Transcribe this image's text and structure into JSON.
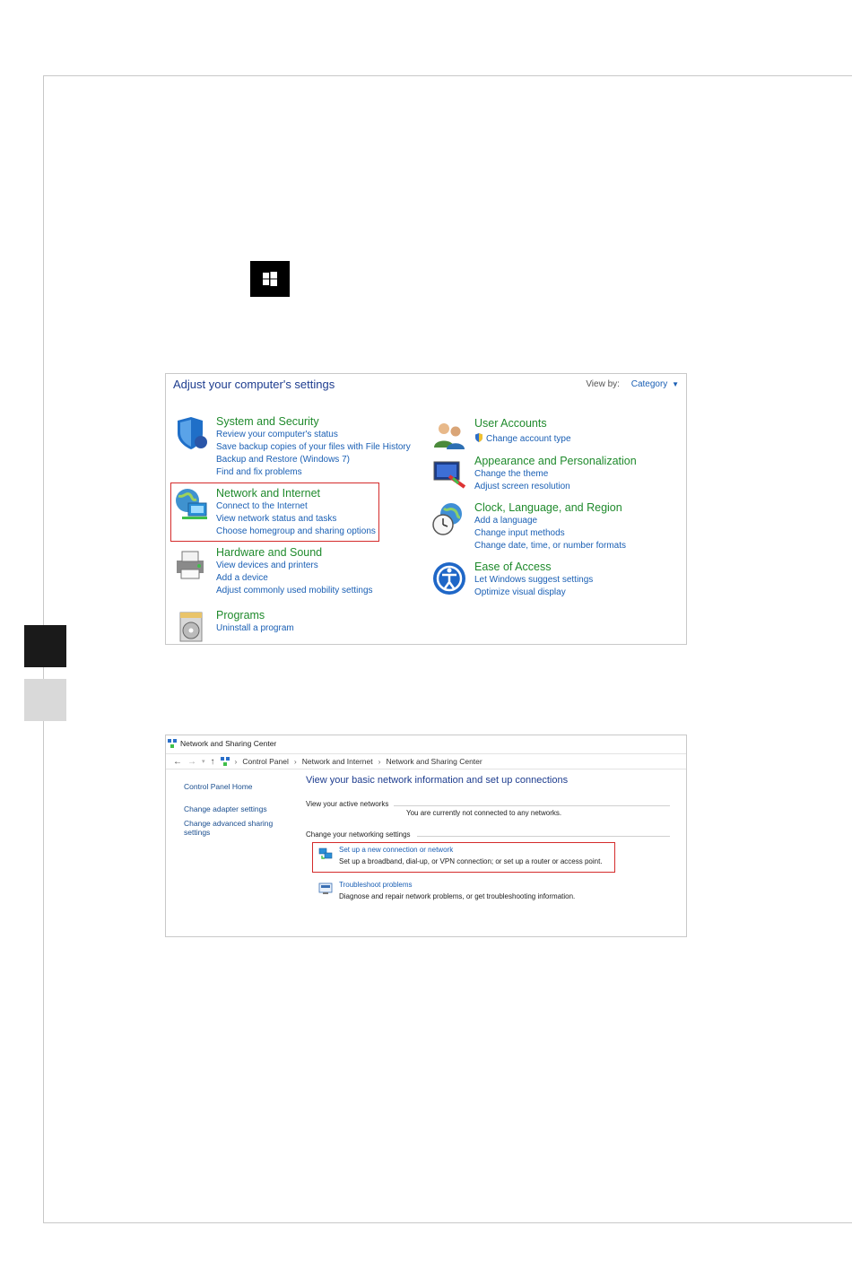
{
  "control_panel": {
    "title": "Adjust your computer's settings",
    "view_by_label": "View by:",
    "view_by_value": "Category",
    "categories": [
      {
        "heading": "System and Security",
        "icon": "shield-icon",
        "links": [
          "Review your computer's status",
          "Save backup copies of your files with File History",
          "Backup and Restore (Windows 7)",
          "Find and fix problems"
        ]
      },
      {
        "heading": "Network and Internet",
        "icon": "network-globe-icon",
        "links": [
          "Connect to the Internet",
          "View network status and tasks",
          "Choose homegroup and sharing options"
        ]
      },
      {
        "heading": "Hardware and Sound",
        "icon": "printer-icon",
        "links": [
          "View devices and printers",
          "Add a device",
          "Adjust commonly used mobility settings"
        ]
      },
      {
        "heading": "Programs",
        "icon": "programs-disc-icon",
        "links": [
          "Uninstall a program"
        ]
      },
      {
        "heading": "User Accounts",
        "icon": "users-icon",
        "links": [
          "Change account type"
        ]
      },
      {
        "heading": "Appearance and Personalization",
        "icon": "display-brush-icon",
        "links": [
          "Change the theme",
          "Adjust screen resolution"
        ]
      },
      {
        "heading": "Clock, Language, and Region",
        "icon": "globe-clock-icon",
        "links": [
          "Add a language",
          "Change input methods",
          "Change date, time, or number formats"
        ]
      },
      {
        "heading": "Ease of Access",
        "icon": "ease-of-access-icon",
        "links": [
          "Let Windows suggest settings",
          "Optimize visual display"
        ]
      }
    ]
  },
  "network_center": {
    "window_title": "Network and Sharing Center",
    "breadcrumb": [
      "Control Panel",
      "Network and Internet",
      "Network and Sharing Center"
    ],
    "left_links": [
      "Control Panel Home",
      "Change adapter settings",
      "Change advanced sharing settings"
    ],
    "heading": "View your basic network information and set up connections",
    "active_networks_label": "View your active networks",
    "not_connected_text": "You are currently not connected to any networks.",
    "change_settings_label": "Change your networking settings",
    "tasks": [
      {
        "link": "Set up a new connection or network",
        "desc": "Set up a broadband, dial-up, or VPN connection; or set up a router or access point."
      },
      {
        "link": "Troubleshoot problems",
        "desc": "Diagnose and repair network problems, or get troubleshooting information."
      }
    ]
  },
  "colors": {
    "category_heading": "#1f8a2c",
    "link": "#1a5fb4",
    "highlight_border": "#d42b2b"
  }
}
